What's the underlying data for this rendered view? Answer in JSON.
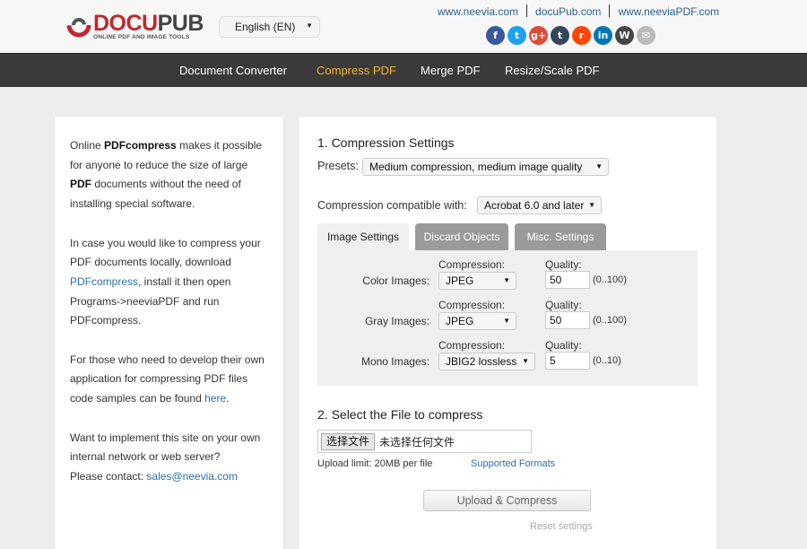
{
  "header": {
    "logo": {
      "brand_part1": "DOCU",
      "brand_part2": "PUB",
      "tagline": "ONLINE PDF AND IMAGE TOOLS"
    },
    "language_select": {
      "value": "English (EN)"
    },
    "top_links": [
      "www.neevia.com",
      "docuPub.com",
      "www.neeviaPDF.com"
    ],
    "social_icons": [
      {
        "name": "facebook-icon",
        "glyph": "f",
        "color": "#3b5998"
      },
      {
        "name": "twitter-icon",
        "glyph": "t",
        "color": "#1da1f2"
      },
      {
        "name": "google-plus-icon",
        "glyph": "g+",
        "color": "#dd4b39"
      },
      {
        "name": "tumblr-icon",
        "glyph": "t",
        "color": "#35465c"
      },
      {
        "name": "reddit-icon",
        "glyph": "r",
        "color": "#ff4500"
      },
      {
        "name": "linkedin-icon",
        "glyph": "in",
        "color": "#0077b5"
      },
      {
        "name": "wordpress-icon",
        "glyph": "W",
        "color": "#464646"
      },
      {
        "name": "email-icon",
        "glyph": "✉",
        "color": "#bbbbbb"
      }
    ]
  },
  "nav": {
    "items": [
      {
        "label": "Document Converter",
        "active": false
      },
      {
        "label": "Compress PDF",
        "active": true
      },
      {
        "label": "Merge PDF",
        "active": false
      },
      {
        "label": "Resize/Scale PDF",
        "active": false
      }
    ],
    "active_color": "#f0b632"
  },
  "sidebar": {
    "p1": {
      "t1": "Online ",
      "b1": "PDFcompress",
      "t2": " makes it possible for anyone to reduce the size of large ",
      "b2": "PDF",
      "t3": " documents without the need of installing special software."
    },
    "p2": {
      "t1": "In case you would like to compress your PDF documents locally, download ",
      "link": "PDFcompress",
      "t2": ", install it then open Programs->neeviaPDF and run PDFcompress."
    },
    "p3": {
      "t1": "For those who need to develop their own application for compressing PDF files code samples can be found ",
      "link": "here",
      "t2": "."
    },
    "p4": {
      "t1": "Want to implement this site on your own internal network or web server?",
      "t2": "Please contact: ",
      "link": "sales@neevia.com"
    }
  },
  "main": {
    "section1_title": "1. Compression Settings",
    "presets_label": "Presets:",
    "presets_value": "Medium compression, medium image quality",
    "compat_label": "Compression compatible with:",
    "compat_value": "Acrobat 6.0 and later",
    "tabs": [
      {
        "label": "Image Settings",
        "active": true
      },
      {
        "label": "Discard Objects",
        "active": false
      },
      {
        "label": "Misc. Settings",
        "active": false
      }
    ],
    "image_rows": [
      {
        "label": "Color Images:",
        "compression_label": "Compression:",
        "compression": "JPEG",
        "quality_label": "Quality:",
        "quality": "50",
        "range": "(0..100)"
      },
      {
        "label": "Gray Images:",
        "compression_label": "Compression:",
        "compression": "JPEG",
        "quality_label": "Quality:",
        "quality": "50",
        "range": "(0..100)"
      },
      {
        "label": "Mono Images:",
        "compression_label": "Compression:",
        "compression": "JBIG2 lossless",
        "quality_label": "Quality:",
        "quality": "5",
        "range": "(0..10)"
      }
    ],
    "section2_title": "2. Select the File to compress",
    "file_button": "选择文件",
    "file_status": "未选择任何文件",
    "upload_limit": "Upload limit: 20MB per file",
    "supported_formats": "Supported Formats",
    "upload_button": "Upload & Compress",
    "reset_link": "Reset settings"
  }
}
